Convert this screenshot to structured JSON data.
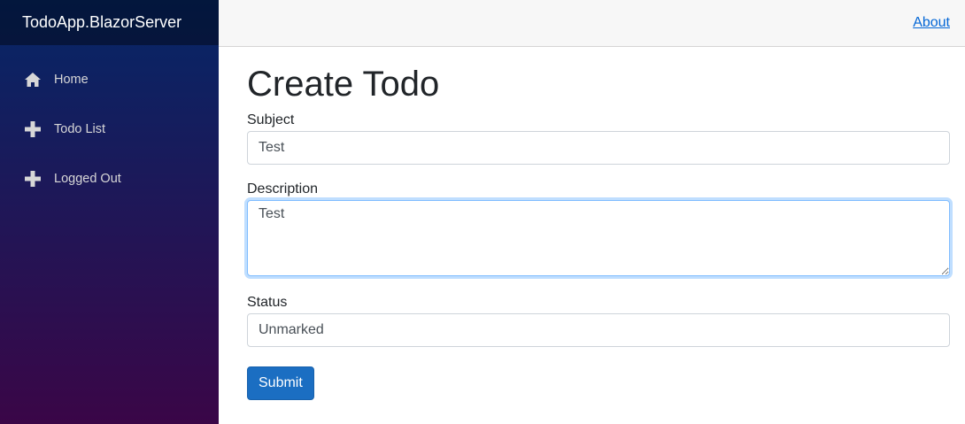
{
  "app": {
    "brand": "TodoApp.BlazorServer"
  },
  "sidebar": {
    "items": [
      {
        "label": "Home",
        "icon": "home-icon"
      },
      {
        "label": "Todo List",
        "icon": "plus-icon"
      },
      {
        "label": "Logged Out",
        "icon": "plus-icon"
      }
    ]
  },
  "header": {
    "about_label": "About"
  },
  "form": {
    "title": "Create Todo",
    "subject_label": "Subject",
    "subject_value": "Test",
    "description_label": "Description",
    "description_value": "Test",
    "status_label": "Status",
    "status_value": "Unmarked",
    "submit_label": "Submit"
  },
  "colors": {
    "sidebar_top": "#052767",
    "sidebar_bottom": "#3a0647",
    "primary": "#1b6ec2",
    "link": "#0366d6"
  }
}
